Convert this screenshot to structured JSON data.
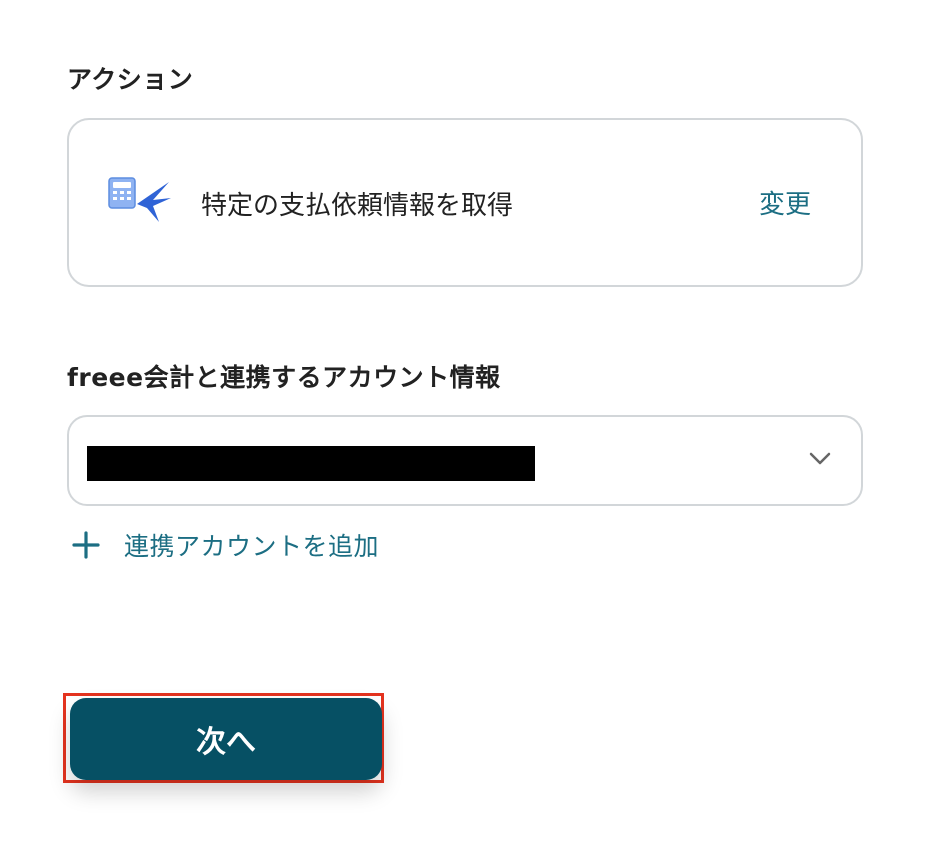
{
  "action_section": {
    "label": "アクション",
    "action_name": "特定の支払依頼情報を取得",
    "change_label": "変更",
    "icon": "freee-calculator-swallow-icon"
  },
  "account_section": {
    "label": "freee会計と連携するアカウント情報",
    "selected_value_redacted": true,
    "add_account_label": "連携アカウントを追加"
  },
  "footer": {
    "next_label": "次へ",
    "highlight_color": "#e4331f"
  },
  "colors": {
    "accent": "#1c6e83",
    "primary_button": "#065064",
    "border": "#d2d6d9"
  }
}
